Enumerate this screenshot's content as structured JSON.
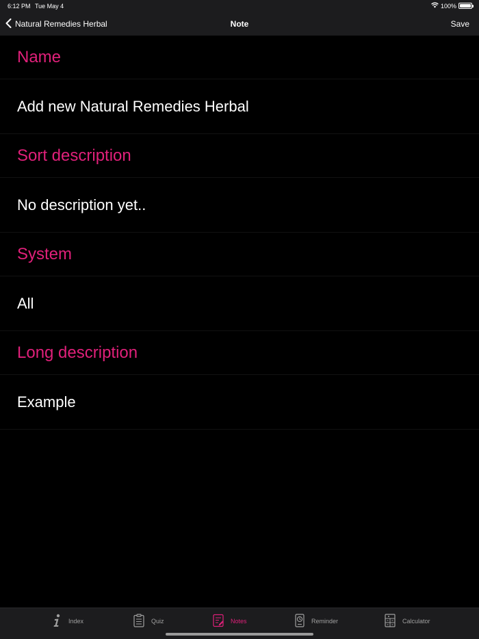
{
  "status_bar": {
    "time": "6:12 PM",
    "date": "Tue May 4",
    "battery": "100%",
    "wifi_icon": "wifi-icon",
    "battery_icon": "battery-icon"
  },
  "nav": {
    "back_label": "Natural Remedies Herbal",
    "title": "Note",
    "save_label": "Save"
  },
  "fields": {
    "name_label": "Name",
    "name_value": "Add new Natural Remedies Herbal",
    "sort_label": "Sort description",
    "sort_value": "No description yet..",
    "system_label": "System",
    "system_value": "All",
    "long_label": "Long description",
    "long_value": "Example"
  },
  "tabs": [
    {
      "label": "Index",
      "icon": "info-icon",
      "active": false
    },
    {
      "label": "Quiz",
      "icon": "clipboard-icon",
      "active": false
    },
    {
      "label": "Notes",
      "icon": "notes-icon",
      "active": true
    },
    {
      "label": "Reminder",
      "icon": "clock-icon",
      "active": false
    },
    {
      "label": "Calculator",
      "icon": "calculator-icon",
      "active": false
    }
  ],
  "colors": {
    "accent": "#e0207a",
    "background": "#000000",
    "bar": "#1c1c1e",
    "inactive": "#a0a0a0"
  }
}
